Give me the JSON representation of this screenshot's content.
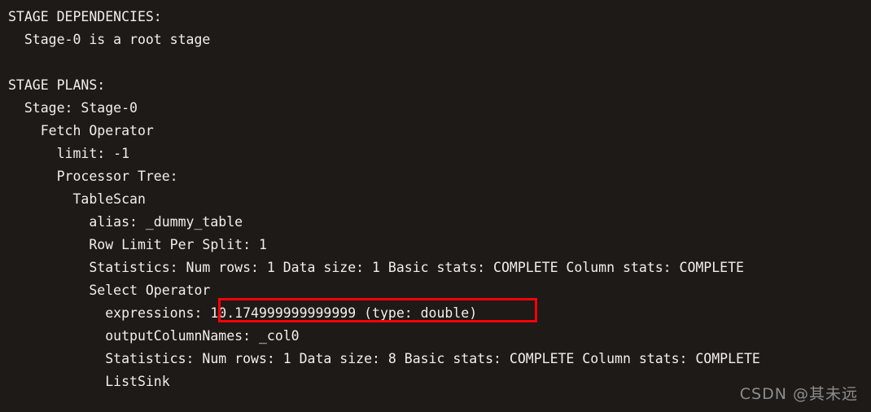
{
  "terminal": {
    "background_color": "#1e1a18",
    "text_color": "#f2efe9",
    "lines": [
      "STAGE DEPENDENCIES:",
      "  Stage-0 is a root stage",
      "",
      "STAGE PLANS:",
      "  Stage: Stage-0",
      "    Fetch Operator",
      "      limit: -1",
      "      Processor Tree:",
      "        TableScan",
      "          alias: _dummy_table",
      "          Row Limit Per Split: 1",
      "          Statistics: Num rows: 1 Data size: 1 Basic stats: COMPLETE Column stats: COMPLETE",
      "          Select Operator",
      "            expressions: 10.174999999999999 (type: double)",
      "            outputColumnNames: _col0",
      "            Statistics: Num rows: 1 Data size: 8 Basic stats: COMPLETE Column stats: COMPLETE",
      "            ListSink"
    ]
  },
  "annotation": {
    "label": "highlight-rectangle",
    "color": "#fb0007",
    "highlighted_text": "10.174999999999999 (type: double)"
  },
  "watermark": {
    "text": "CSDN @其未远",
    "color": "#8d8d8d"
  }
}
